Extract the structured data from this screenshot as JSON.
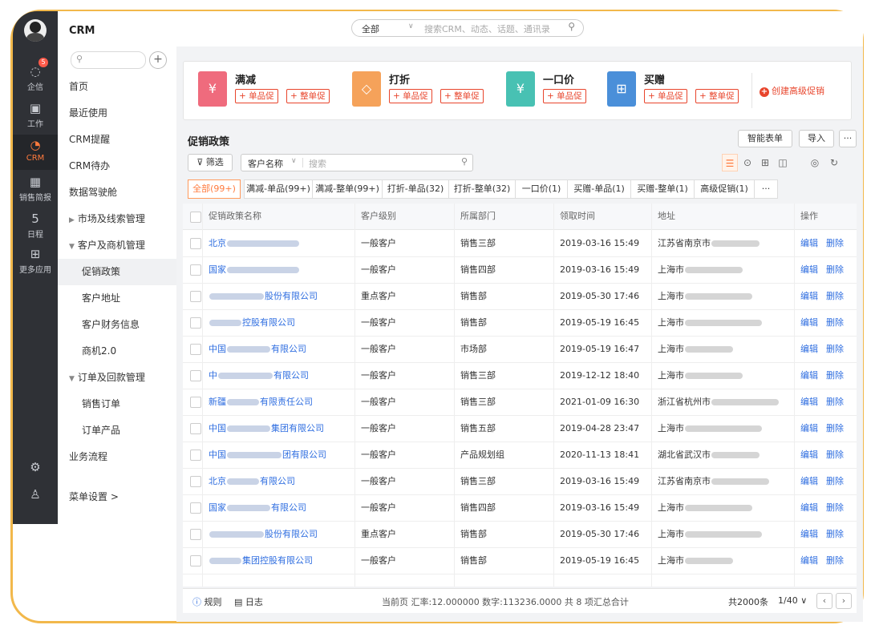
{
  "rail": {
    "items": [
      {
        "label": "企信",
        "icon": "chat-bubble-icon",
        "badge": "5"
      },
      {
        "label": "工作",
        "icon": "work-icon"
      },
      {
        "label": "CRM",
        "icon": "crm-icon",
        "active": true
      },
      {
        "label": "销售简报",
        "icon": "report-icon"
      },
      {
        "label": "日程",
        "icon": "calendar-icon",
        "day": "5"
      },
      {
        "label": "更多应用",
        "icon": "grid-icon"
      }
    ]
  },
  "nav": {
    "title": "CRM",
    "search_placeholder": "Q",
    "items": [
      {
        "label": "首页",
        "level": 0
      },
      {
        "label": "最近使用",
        "level": 0
      },
      {
        "label": "CRM提醒",
        "level": 0
      },
      {
        "label": "CRM待办",
        "level": 0
      },
      {
        "label": "数据驾驶舱",
        "level": 0
      },
      {
        "label": "市场及线索管理",
        "level": 0,
        "arrow": "▶"
      },
      {
        "label": "客户及商机管理",
        "level": 0,
        "arrow": "▼"
      },
      {
        "label": "促销政策",
        "level": 1,
        "selected": true
      },
      {
        "label": "客户地址",
        "level": 1
      },
      {
        "label": "客户财务信息",
        "level": 1
      },
      {
        "label": "商机2.0",
        "level": 1
      },
      {
        "label": "订单及回款管理",
        "level": 0,
        "arrow": "▼"
      },
      {
        "label": "销售订单",
        "level": 1
      },
      {
        "label": "订单产品",
        "level": 1
      },
      {
        "label": "业务流程",
        "level": 0
      }
    ],
    "menu_settings": "菜单设置 >"
  },
  "topbar": {
    "scope": "全部",
    "placeholder": "搜索CRM、动态、话题、通讯录"
  },
  "promo": {
    "types": [
      {
        "name": "满减",
        "color": "#ef6b7d",
        "icon": "¥",
        "buttons": [
          "+ 单品促",
          "+ 整单促"
        ]
      },
      {
        "name": "打折",
        "color": "#f5a25a",
        "icon": "◇",
        "buttons": [
          "+ 单品促",
          "+ 整单促"
        ]
      },
      {
        "name": "一口价",
        "color": "#48c1b3",
        "icon": "¥",
        "buttons": [
          "+ 单品促"
        ]
      },
      {
        "name": "买赠",
        "color": "#4a8fd9",
        "icon": "⊞",
        "buttons": [
          "+ 单品促",
          "+ 整单促"
        ]
      }
    ],
    "advanced": "创建高级促销"
  },
  "page": {
    "title": "促销政策",
    "smart_table": "智能表单",
    "import": "导入",
    "more": "···",
    "filter": "筛选",
    "field": "客户名称",
    "search_placeholder": "搜索"
  },
  "tabs": [
    "全部(99+)",
    "满减-单品(99+)",
    "满减-整单(99+)",
    "打折-单品(32)",
    "打折-整单(32)",
    "一口价(1)",
    "买赠-单品(1)",
    "买赠-整单(1)",
    "高级促销(1)",
    "···"
  ],
  "table": {
    "columns": [
      "促销政策名称",
      "客户级别",
      "所属部门",
      "领取时间",
      "地址",
      "操作"
    ],
    "rows": [
      {
        "name_prefix": "北京",
        "name_suffix": "",
        "level": "一般客户",
        "dept": "销售三部",
        "time": "2019-03-16 15:49",
        "addr": "江苏省南京市"
      },
      {
        "name_prefix": "国家",
        "name_suffix": "",
        "level": "一般客户",
        "dept": "销售四部",
        "time": "2019-03-16 15:49",
        "addr": "上海市"
      },
      {
        "name_prefix": "",
        "name_suffix": "股份有限公司",
        "level": "重点客户",
        "dept": "销售部",
        "time": "2019-05-30 17:46",
        "addr": "上海市"
      },
      {
        "name_prefix": "",
        "name_suffix": "控股有限公司",
        "level": "一般客户",
        "dept": "销售部",
        "time": "2019-05-19 16:45",
        "addr": "上海市"
      },
      {
        "name_prefix": "中国",
        "name_suffix": "有限公司",
        "level": "一般客户",
        "dept": "市场部",
        "time": "2019-05-19 16:47",
        "addr": "上海市"
      },
      {
        "name_prefix": "中",
        "name_suffix": "有限公司",
        "level": "一般客户",
        "dept": "销售三部",
        "time": "2019-12-12 18:40",
        "addr": "上海市"
      },
      {
        "name_prefix": "新疆",
        "name_suffix": "有限责任公司",
        "level": "一般客户",
        "dept": "销售三部",
        "time": "2021-01-09 16:30",
        "addr": "浙江省杭州市"
      },
      {
        "name_prefix": "中国",
        "name_suffix": "集团有限公司",
        "level": "一般客户",
        "dept": "销售五部",
        "time": "2019-04-28 23:47",
        "addr": "上海市"
      },
      {
        "name_prefix": "中国",
        "name_suffix": "团有限公司",
        "level": "一般客户",
        "dept": "产品规划组",
        "time": "2020-11-13 18:41",
        "addr": "湖北省武汉市"
      },
      {
        "name_prefix": "北京",
        "name_suffix": "有限公司",
        "level": "一般客户",
        "dept": "销售三部",
        "time": "2019-03-16 15:49",
        "addr": "江苏省南京市"
      },
      {
        "name_prefix": "国家",
        "name_suffix": "有限公司",
        "level": "一般客户",
        "dept": "销售四部",
        "time": "2019-03-16 15:49",
        "addr": "上海市"
      },
      {
        "name_prefix": "",
        "name_suffix": "股份有限公司",
        "level": "重点客户",
        "dept": "销售部",
        "time": "2019-05-30 17:46",
        "addr": "上海市"
      },
      {
        "name_prefix": "",
        "name_suffix": "集团控股有限公司",
        "level": "一般客户",
        "dept": "销售部",
        "time": "2019-05-19 16:45",
        "addr": "上海市"
      }
    ],
    "edit": "编辑",
    "delete": "删除"
  },
  "footer": {
    "rules": "规则",
    "log": "日志",
    "summary": "当前页  汇率:12.000000  数字:113236.0000 共 8 项汇总合计",
    "total": "共2000条",
    "page": "1/40"
  }
}
